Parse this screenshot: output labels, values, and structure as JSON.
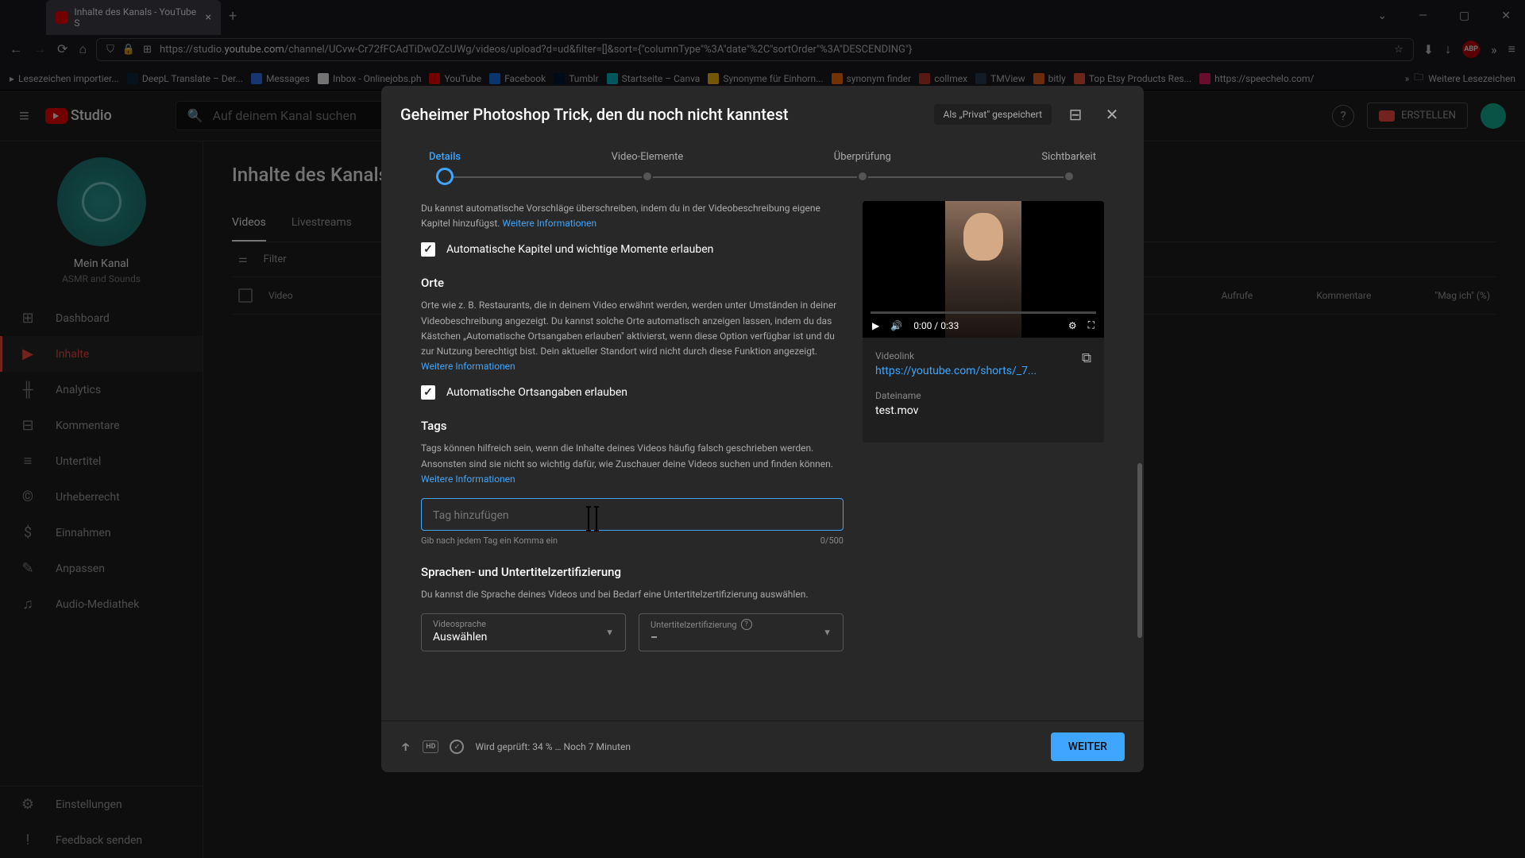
{
  "browser": {
    "tab_title": "Inhalte des Kanals - YouTube S",
    "url_prefix": "https://studio.",
    "url_domain": "youtube.com",
    "url_path": "/channel/UCvw-Cr72fFCAdTiDwOZcUWg/videos/upload?d=ud&filter=[]&sort={\"columnType\"%3A\"date\"%2C\"sortOrder\"%3A\"DESCENDING\"}",
    "bookmarks": [
      "Lesezeichen importier...",
      "DeepL Translate – Der...",
      "Messages",
      "Inbox - Onlinejobs.ph",
      "YouTube",
      "Facebook",
      "Tumblr",
      "Startseite – Canva",
      "Synonyme für Einhorn...",
      "synonym finder",
      "collmex",
      "TMView",
      "bitly",
      "Top Etsy Products Res...",
      "https://speechelo.com/"
    ],
    "more_bookmarks": "Weitere Lesezeichen"
  },
  "studio": {
    "logo": "Studio",
    "search_placeholder": "Auf deinem Kanal suchen",
    "create_btn": "ERSTELLEN",
    "channel_name": "Mein Kanal",
    "channel_sub": "ASMR and Sounds",
    "nav": [
      {
        "icon": "⊞",
        "label": "Dashboard"
      },
      {
        "icon": "▶",
        "label": "Inhalte"
      },
      {
        "icon": "╫",
        "label": "Analytics"
      },
      {
        "icon": "⊟",
        "label": "Kommentare"
      },
      {
        "icon": "≡",
        "label": "Untertitel"
      },
      {
        "icon": "©",
        "label": "Urheberrecht"
      },
      {
        "icon": "$",
        "label": "Einnahmen"
      },
      {
        "icon": "✎",
        "label": "Anpassen"
      },
      {
        "icon": "♫",
        "label": "Audio-Mediathek"
      }
    ],
    "nav_bottom": [
      {
        "icon": "⚙",
        "label": "Einstellungen"
      },
      {
        "icon": "!",
        "label": "Feedback senden"
      }
    ],
    "content_title": "Inhalte des Kanals",
    "tabs": [
      "Videos",
      "Livestreams"
    ],
    "filter_label": "Filter",
    "columns": {
      "video": "Video",
      "views": "Aufrufe",
      "comments": "Kommentare",
      "likes": "\"Mag ich\" (%)"
    }
  },
  "modal": {
    "title": "Geheimer Photoshop Trick, den du noch nicht kanntest",
    "privacy": "Als „Privat\" gespeichert",
    "steps": [
      "Details",
      "Video-Elemente",
      "Überprüfung",
      "Sichtbarkeit"
    ],
    "chapters_desc": "Du kannst automatische Vorschläge überschreiben, indem du in der Videobeschreibung eigene Kapitel hinzufügst. ",
    "more_info": "Weitere Informationen",
    "chapters_check": "Automatische Kapitel und wichtige Momente erlauben",
    "places_heading": "Orte",
    "places_desc": "Orte wie z. B. Restaurants, die in deinem Video erwähnt werden, werden unter Umständen in deiner Videobeschreibung angezeigt. Du kannst solche Orte automatisch anzeigen lassen, indem du das Kästchen „Automatische Ortsangaben erlauben\" aktivierst, wenn diese Option verfügbar ist und du zur Nutzung berechtigt bist. Dein aktueller Standort wird nicht durch diese Funktion angezeigt. ",
    "places_check": "Automatische Ortsangaben erlauben",
    "tags_heading": "Tags",
    "tags_desc": "Tags können hilfreich sein, wenn die Inhalte deines Videos häufig falsch geschrieben werden. Ansonsten sind sie nicht so wichtig dafür, wie Zuschauer deine Videos suchen und finden können. ",
    "tags_placeholder": "Tag hinzufügen",
    "tags_hint": "Gib nach jedem Tag ein Komma ein",
    "tags_counter": "0/500",
    "lang_heading": "Sprachen- und Untertitelzertifizierung",
    "lang_desc": "Du kannst die Sprache deines Videos und bei Bedarf eine Untertitelzertifizierung auswählen.",
    "lang_select_label": "Videosprache",
    "lang_select_value": "Auswählen",
    "cert_select_label": "Untertitelzertifizierung",
    "cert_select_value": "–",
    "video_time": "0:00 / 0:33",
    "videolink_label": "Videolink",
    "videolink_value": "https://youtube.com/shorts/_7...",
    "filename_label": "Dateiname",
    "filename_value": "test.mov",
    "footer_status": "Wird geprüft: 34 % … Noch 7 Minuten",
    "next_btn": "WEITER"
  }
}
